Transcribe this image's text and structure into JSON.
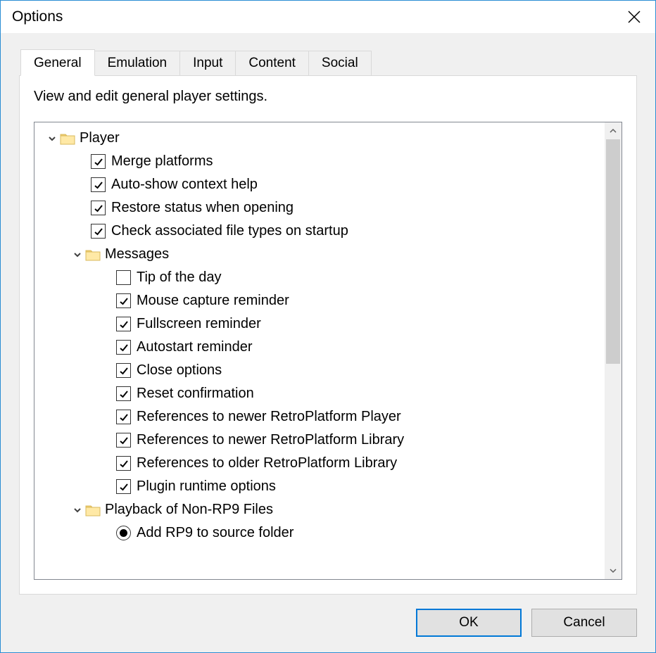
{
  "window": {
    "title": "Options"
  },
  "tabs": [
    {
      "label": "General",
      "active": true
    },
    {
      "label": "Emulation",
      "active": false
    },
    {
      "label": "Input",
      "active": false
    },
    {
      "label": "Content",
      "active": false
    },
    {
      "label": "Social",
      "active": false
    }
  ],
  "panel": {
    "description": "View and edit general player settings."
  },
  "tree": [
    {
      "level": 0,
      "type": "group",
      "label": "Player",
      "expanded": true
    },
    {
      "level": 1,
      "type": "check",
      "label": "Merge platforms",
      "checked": true
    },
    {
      "level": 1,
      "type": "check",
      "label": "Auto-show context help",
      "checked": true
    },
    {
      "level": 1,
      "type": "check",
      "label": "Restore status when opening",
      "checked": true
    },
    {
      "level": 1,
      "type": "check",
      "label": "Check associated file types on startup",
      "checked": true
    },
    {
      "level": 1,
      "type": "group",
      "label": "Messages",
      "expanded": true
    },
    {
      "level": 2,
      "type": "check",
      "label": "Tip of the day",
      "checked": false
    },
    {
      "level": 2,
      "type": "check",
      "label": "Mouse capture reminder",
      "checked": true
    },
    {
      "level": 2,
      "type": "check",
      "label": "Fullscreen reminder",
      "checked": true
    },
    {
      "level": 2,
      "type": "check",
      "label": "Autostart reminder",
      "checked": true
    },
    {
      "level": 2,
      "type": "check",
      "label": "Close options",
      "checked": true
    },
    {
      "level": 2,
      "type": "check",
      "label": "Reset confirmation",
      "checked": true
    },
    {
      "level": 2,
      "type": "check",
      "label": "References to newer RetroPlatform Player",
      "checked": true
    },
    {
      "level": 2,
      "type": "check",
      "label": "References to newer RetroPlatform Library",
      "checked": true
    },
    {
      "level": 2,
      "type": "check",
      "label": "References to older RetroPlatform Library",
      "checked": true
    },
    {
      "level": 2,
      "type": "check",
      "label": "Plugin runtime options",
      "checked": true
    },
    {
      "level": 1,
      "type": "group",
      "label": "Playback of Non-RP9 Files",
      "expanded": true
    },
    {
      "level": 2,
      "type": "radio",
      "label": "Add RP9 to source folder",
      "checked": true
    }
  ],
  "buttons": {
    "ok": "OK",
    "cancel": "Cancel"
  }
}
